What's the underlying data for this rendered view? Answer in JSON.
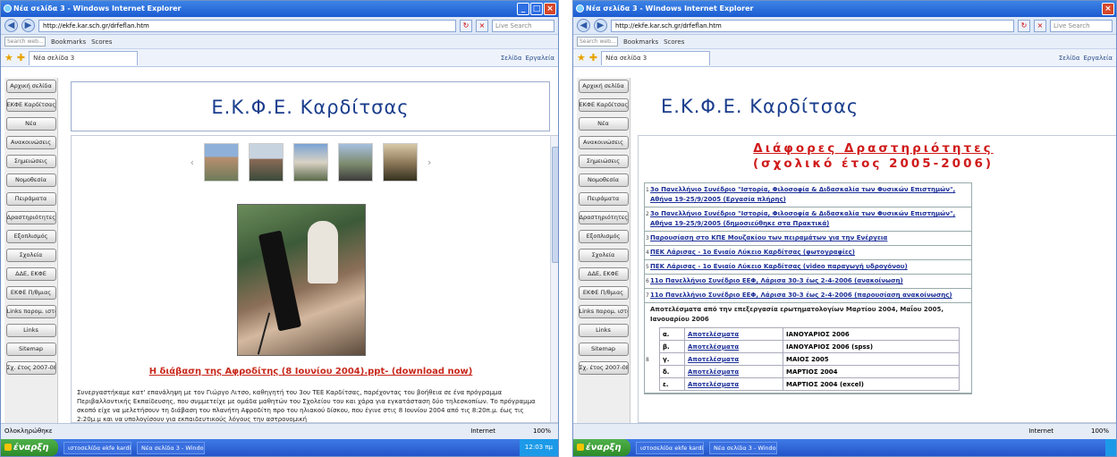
{
  "window": {
    "title": "Νέα σελίδα 3 - Windows Internet Explorer",
    "address": "http://ekfe.kar.sch.gr/drfeflan.htm",
    "live_search_placeholder": "Live Search",
    "toolbar_search_placeholder": "Search web...",
    "toolbar_items": [
      "Bookmarks",
      "Scores"
    ],
    "tab_title": "Νέα σελίδα 3",
    "fav_right": [
      "Σελίδα",
      "Εργαλεία"
    ],
    "status_left": "Ολοκληρώθηκε",
    "status_zone": "Internet",
    "zoom": "100%",
    "start_label": "έναρξη",
    "task_items": [
      "ιστοσελίδα ekfe karditsa...",
      "Νέα σελίδα 3 - Windo..."
    ],
    "clock": "12:03 πμ"
  },
  "site": {
    "header_title": "Ε.Κ.Φ.Ε. Καρδίτσας",
    "sidebar_left": [
      "Αρχική σελίδα",
      "ΕΚΦΕ Καρδίτσας",
      "Νέα",
      "Ανακοινώσεις",
      "Σημειώσεις",
      "Νομοθεσία",
      "Πειράματα",
      "Δραστηριότητες",
      "Εξοπλισμός",
      "Σχολεία",
      "ΔΔΕ, ΕΚΦΕ",
      "ΕΚΦΕ Π/θμιας",
      "Links παρομ. ιστών",
      "Links",
      "Sitemap",
      "Σχ. έτος 2007-08"
    ],
    "sidebar_right": [
      "Αρχική σελίδα",
      "ΕΚΦΕ Καρδίτσας",
      "Νέα",
      "Ανακοινώσεις",
      "Σημειώσεις",
      "Νομοθεσία",
      "Πειράματα",
      "Δραστηριότητες",
      "Εξοπλισμός",
      "Σχολεία",
      "ΔΔΕ, ΕΚΦΕ",
      "ΕΚΦΕ Π/θμιας",
      "Links παρομ. ιστών",
      "Links",
      "Sitemap",
      "Σχ. έτος 2007-08"
    ]
  },
  "left_page": {
    "download_link": "Η διάβαση της Αφροδίτης (8 Ιουνίου 2004).ppt- (download now)",
    "paragraph": "Συνεργαστήκαμε κατ' επανάληψη με τον Γιώργο Λιτσο, καθηγητή του 3ου ΤΕΕ Καρδίτσας, παρέχοντας του βοήθεια σε ένα πρόγραμμα Περιβαλλοντικής Εκπαίδευσης, που συμμετείχε με ομάδα μαθητών του Σχολείου του και χάρα για εγκατάσταση δύο τηλεσκοπίων. Το πρόγραμμα σκοπό είχε να μελετήσουν τη διάβαση του πλανήτη Αφροδίτη προ του ηλιακού δίσκου, που έγινε στις 8 Ιουνίου 2004 από τις 8:20π.μ. έως τις 2:20μ.μ και να υπολογίσουν για εκπαιδευτικούς λόγους την αστρονομική"
  },
  "right_page": {
    "title_line1": "Διάφορες Δραστηριότητες",
    "title_line2": "(σχολικό έτος 2005-2006)",
    "items": [
      {
        "n": "1",
        "text": "3ο Πανελλήνιο Συνέδριο \"Ιστορία, Φιλοσοφία & Διδασκαλία των Φυσικών Επιστημών\", Αθήνα 19-25/9/2005 (Εργασία πλήρης)",
        "link": true
      },
      {
        "n": "2",
        "text": "3ο Πανελλήνιο Συνέδριο \"Ιστορία, Φιλοσοφία & Διδασκαλία των Φυσικών Επιστημών\", Αθήνα 19-25/9/2005 (δημοσιεύθηκε στα Πρακτικά)",
        "link": true
      },
      {
        "n": "3",
        "text": "Παρουσίαση στο ΚΠΕ Μουζακίου των πειραμάτων για την Ενέργεια",
        "link": true
      },
      {
        "n": "4",
        "text": "ΠΕΚ Λάρισας - 1ο Ενιαίο Λύκειο Καρδίτσας (φωτογραφίες)",
        "link": true
      },
      {
        "n": "5",
        "text": "ΠΕΚ Λάρισας - 1ο Ενιαίο Λύκειο Καρδίτσας (video παραγωγή υδρογόνου)",
        "link": true
      },
      {
        "n": "6",
        "text": "11ο Πανελλήνιο Συνέδριο ΕΕΦ, Λάρισα 30-3 έως 2-4-2006 (ανακοίνωση)",
        "link": true
      },
      {
        "n": "7",
        "text": "11ο Πανελλήνιο Συνέδριο ΕΕΦ, Λάρισα 30-3 έως 2-4-2006 (παρουσίαση ανακοίνωσης)",
        "link": true
      }
    ],
    "item8_text": "Αποτελέσματα από την επεξεργασία ερωτηματολογίων Μαρτίου 2004, Μαΐου 2005, Ιανουαρίου 2006",
    "item8_n": "8",
    "sub_rows": [
      {
        "a": "α.",
        "b": "Αποτελέσματα",
        "c": "ΙΑΝΟΥΑΡΙΟΣ 2006"
      },
      {
        "a": "β.",
        "b": "Αποτελέσματα",
        "c": "ΙΑΝΟΥΑΡΙΟΣ 2006 (spss)"
      },
      {
        "a": "γ.",
        "b": "Αποτελέσματα",
        "c": "ΜΑΙΟΣ 2005"
      },
      {
        "a": "δ.",
        "b": "Αποτελέσματα",
        "c": "ΜΑΡΤΙΟΣ 2004"
      },
      {
        "a": "ε.",
        "b": "Αποτελέσματα",
        "c": "ΜΑΡΤΙΟΣ 2004 (excel)"
      }
    ]
  },
  "colors": {
    "header_text": "#1a3d8c",
    "accent_red": "#d01a1a",
    "link_blue": "#1c2f98"
  }
}
